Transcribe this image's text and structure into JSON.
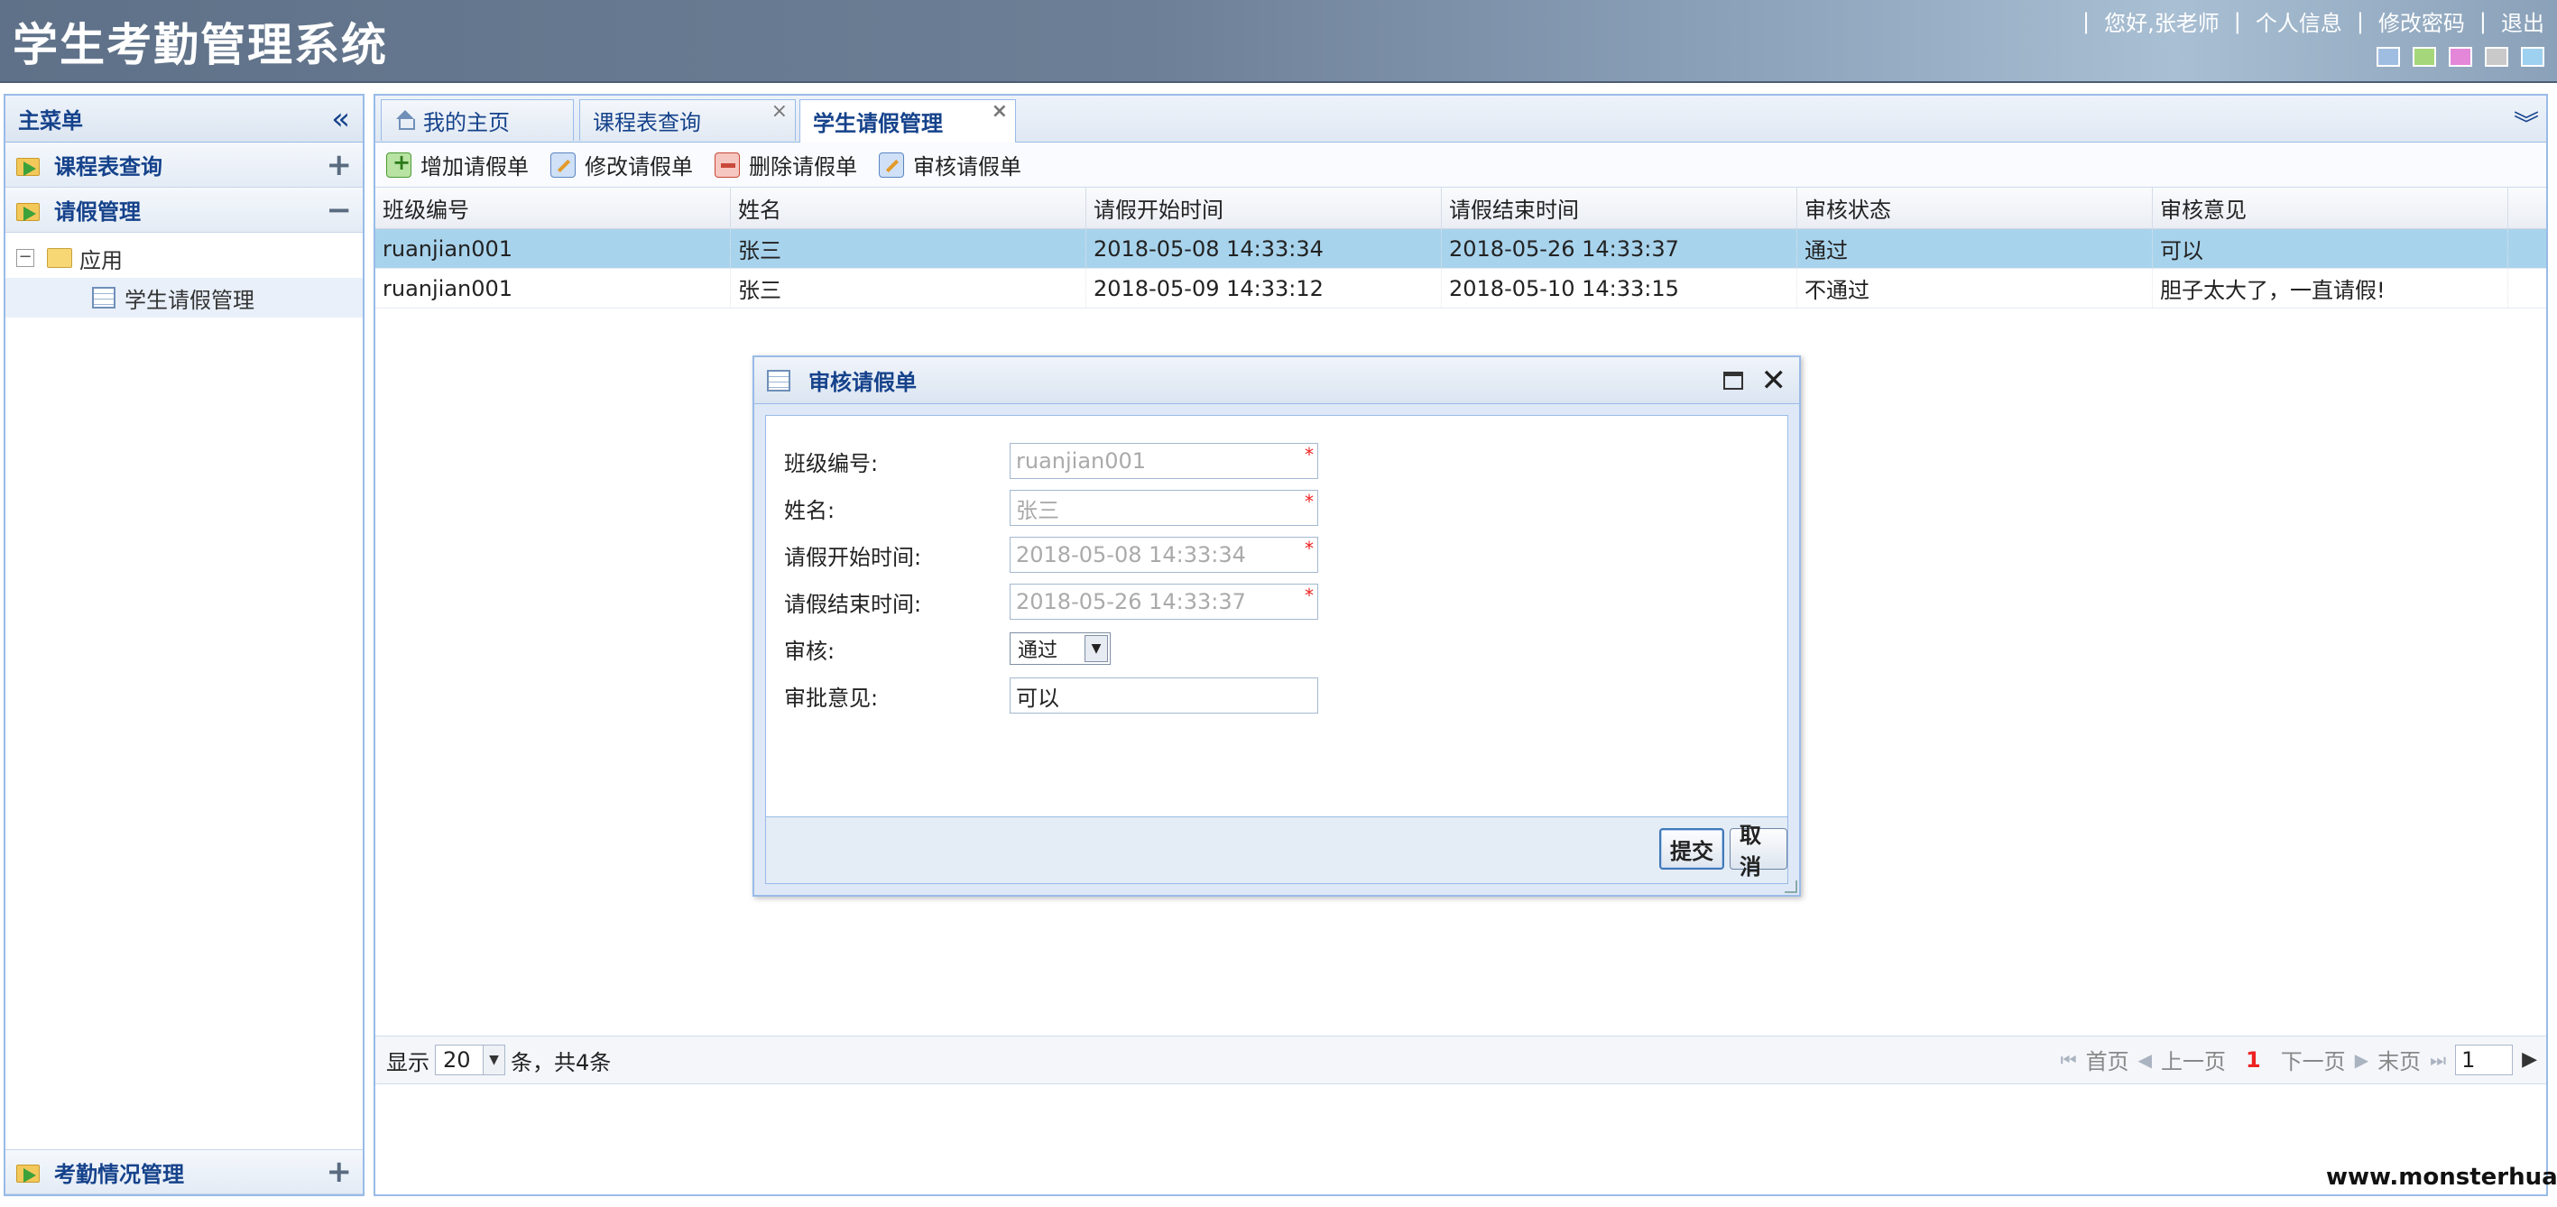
{
  "app": {
    "title": "学生考勤管理系统"
  },
  "top_links": {
    "greeting": "您好,张老师",
    "profile": "个人信息",
    "change_password": "修改密码",
    "logout": "退出",
    "sep": "|"
  },
  "themes": [
    {
      "name": "theme-blue",
      "color": "#9fbde0"
    },
    {
      "name": "theme-green",
      "color": "#a6d67a"
    },
    {
      "name": "theme-pink",
      "color": "#e487d9"
    },
    {
      "name": "theme-gray",
      "color": "#c9c9c9"
    },
    {
      "name": "theme-light-blue",
      "color": "#9ed0ef"
    }
  ],
  "sidebar": {
    "title": "主菜单",
    "sections": [
      {
        "label": "课程表查询"
      },
      {
        "label": "请假管理"
      },
      {
        "label": "考勤情况管理"
      }
    ],
    "tree": {
      "root": "应用",
      "child": "学生请假管理"
    }
  },
  "tabs": [
    {
      "label": "我的主页"
    },
    {
      "label": "课程表查询"
    },
    {
      "label": "学生请假管理"
    }
  ],
  "toolbar": {
    "add": "增加请假单",
    "edit": "修改请假单",
    "delete": "删除请假单",
    "review": "审核请假单"
  },
  "table": {
    "headers": [
      "班级编号",
      "姓名",
      "请假开始时间",
      "请假结束时间",
      "审核状态",
      "审核意见"
    ],
    "rows": [
      [
        "ruanjian001",
        "张三",
        "2018-05-08 14:33:34",
        "2018-05-26 14:33:37",
        "通过",
        "可以"
      ],
      [
        "ruanjian001",
        "张三",
        "2018-05-09 14:33:12",
        "2018-05-10 14:33:15",
        "不通过",
        "胆子太大了，一直请假!"
      ]
    ]
  },
  "pager": {
    "show": "显示",
    "page_size": "20",
    "summary": "条，共4条",
    "first": "首页",
    "prev": "上一页",
    "current": "1",
    "next": "下一页",
    "last": "末页",
    "page_input": "1"
  },
  "dialog": {
    "title": "审核请假单",
    "fields": [
      {
        "label": "班级编号:",
        "value": "ruanjian001",
        "required": "*"
      },
      {
        "label": "姓名:",
        "value": "张三",
        "required": "*"
      },
      {
        "label": "请假开始时间:",
        "value": "2018-05-08 14:33:34",
        "required": "*"
      },
      {
        "label": "请假结束时间:",
        "value": "2018-05-26 14:33:37",
        "required": "*"
      }
    ],
    "review_label": "审核:",
    "review_value": "通过",
    "opinion_label": "审批意见:",
    "opinion_value": "可以",
    "submit": "提交",
    "cancel": "取消"
  },
  "watermark": "www.monsterhua.com"
}
